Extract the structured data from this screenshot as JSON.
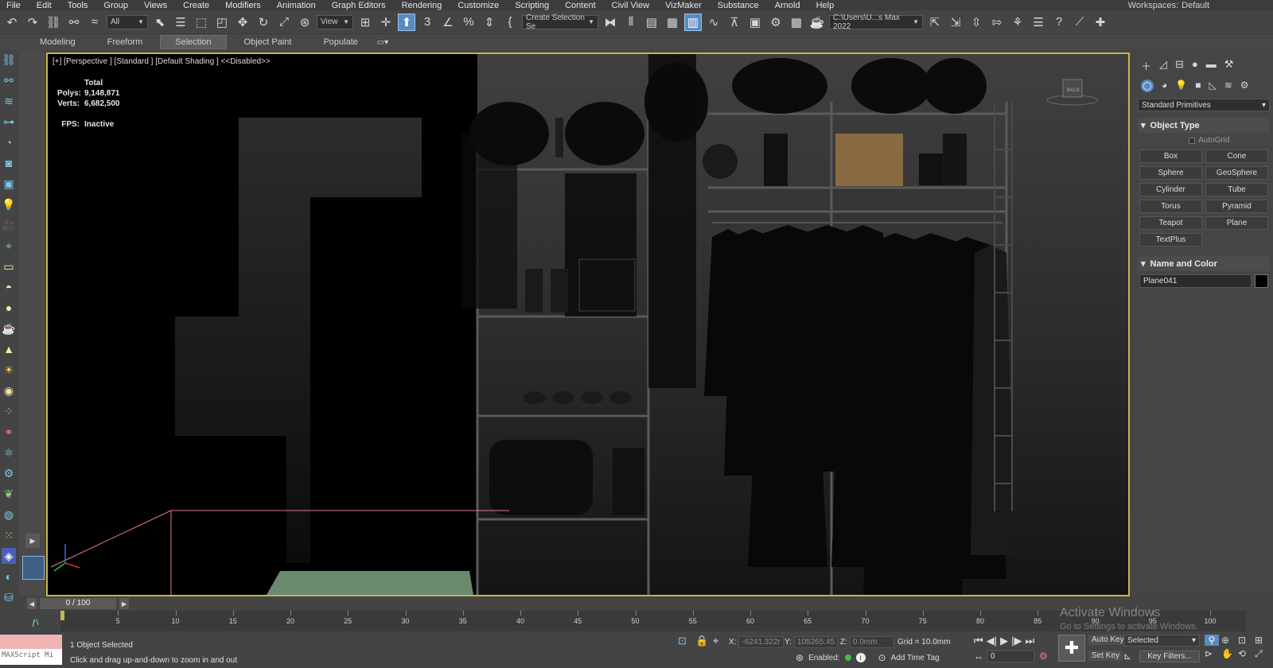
{
  "menubar": {
    "items": [
      "File",
      "Edit",
      "Tools",
      "Group",
      "Views",
      "Create",
      "Modifiers",
      "Animation",
      "Graph Editors",
      "Rendering",
      "Customize",
      "Scripting",
      "Content",
      "Civil View",
      "VizMaker",
      "Substance",
      "Arnold",
      "Help"
    ],
    "workspaces_label": "Workspaces:",
    "workspaces_value": "Default"
  },
  "toolbar": {
    "filter_value": "All",
    "refcoord_value": "View",
    "selection_set_value": "Create Selection Se",
    "project_path": "C:\\Users\\U...s Max 2022"
  },
  "ribbon": {
    "tabs": [
      "Modeling",
      "Freeform",
      "Selection",
      "Object Paint",
      "Populate"
    ],
    "active_tab": "Selection"
  },
  "viewport": {
    "label": "[+] [Perspective ] [Standard ] [Default Shading ]  <<Disabled>>",
    "stats": {
      "total_label": "Total",
      "polys_label": "Polys:",
      "polys_value": "9,148,871",
      "verts_label": "Verts:",
      "verts_value": "6,682,500",
      "fps_label": "FPS:",
      "fps_value": "Inactive"
    },
    "viewcube_text": "BACK"
  },
  "command_panel": {
    "category_value": "Standard Primitives",
    "object_type_title": "Object Type",
    "autogrid_label": "AutoGrid",
    "buttons": [
      "Box",
      "Cone",
      "Sphere",
      "GeoSphere",
      "Cylinder",
      "Tube",
      "Torus",
      "Pyramid",
      "Teapot",
      "Plane",
      "TextPlus"
    ],
    "name_color_title": "Name and Color",
    "object_name": "Plane041",
    "object_color": "#000000"
  },
  "timeslider": {
    "frame_display": "0 / 100"
  },
  "trackbar": {
    "ticks": [
      "5",
      "10",
      "15",
      "20",
      "25",
      "30",
      "35",
      "40",
      "45",
      "50",
      "55",
      "60",
      "65",
      "70",
      "75",
      "80",
      "85",
      "90",
      "95",
      "100"
    ]
  },
  "statusbar": {
    "maxscript_label": "MAXScript Mi",
    "selection_status": "1 Object Selected",
    "prompt": "Click and drag up-and-down to zoom in and out",
    "x_label": "X:",
    "x_value": "-6241.322r",
    "y_label": "Y:",
    "y_value": "105265.45",
    "z_label": "Z:",
    "z_value": "0.0mm",
    "grid": "Grid = 10.0mm",
    "enabled_label": "Enabled:",
    "add_time_tag": "Add Time Tag",
    "frame_value": "0",
    "auto_key": "Auto Key",
    "set_key": "Set Key",
    "selected_value": "Selected",
    "key_filters": "Key Filters..."
  },
  "watermark": {
    "line1": "Activate Windows",
    "line2": "Go to Settings to activate Windows."
  },
  "colors": {
    "viewport_border": "#c8b44a",
    "active_button": "#5b8ac1",
    "ui_background": "#444444"
  }
}
